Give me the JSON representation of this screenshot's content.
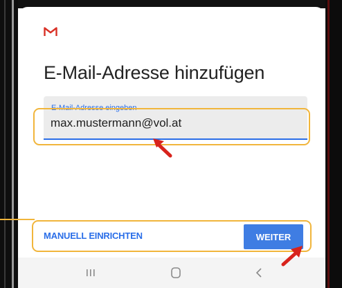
{
  "header": {
    "logo_icon": "gmail-m-icon",
    "title": "E-Mail-Adresse hinzufügen"
  },
  "email_field": {
    "label": "E-Mail-Adresse eingeben",
    "value": "max.mustermann@vol.at"
  },
  "actions": {
    "manual_setup_label": "MANUELL EINRICHTEN",
    "next_label": "WEITER"
  },
  "nav_bar": {
    "recent_icon": "recent-apps-icon",
    "home_icon": "home-icon",
    "back_icon": "back-icon"
  },
  "colors": {
    "accent_blue": "#2a6ee8",
    "button_blue": "#3f7de3",
    "highlight_orange": "#f1b53b",
    "annotation_red": "#d8231c",
    "gmail_red": "#d93025"
  }
}
